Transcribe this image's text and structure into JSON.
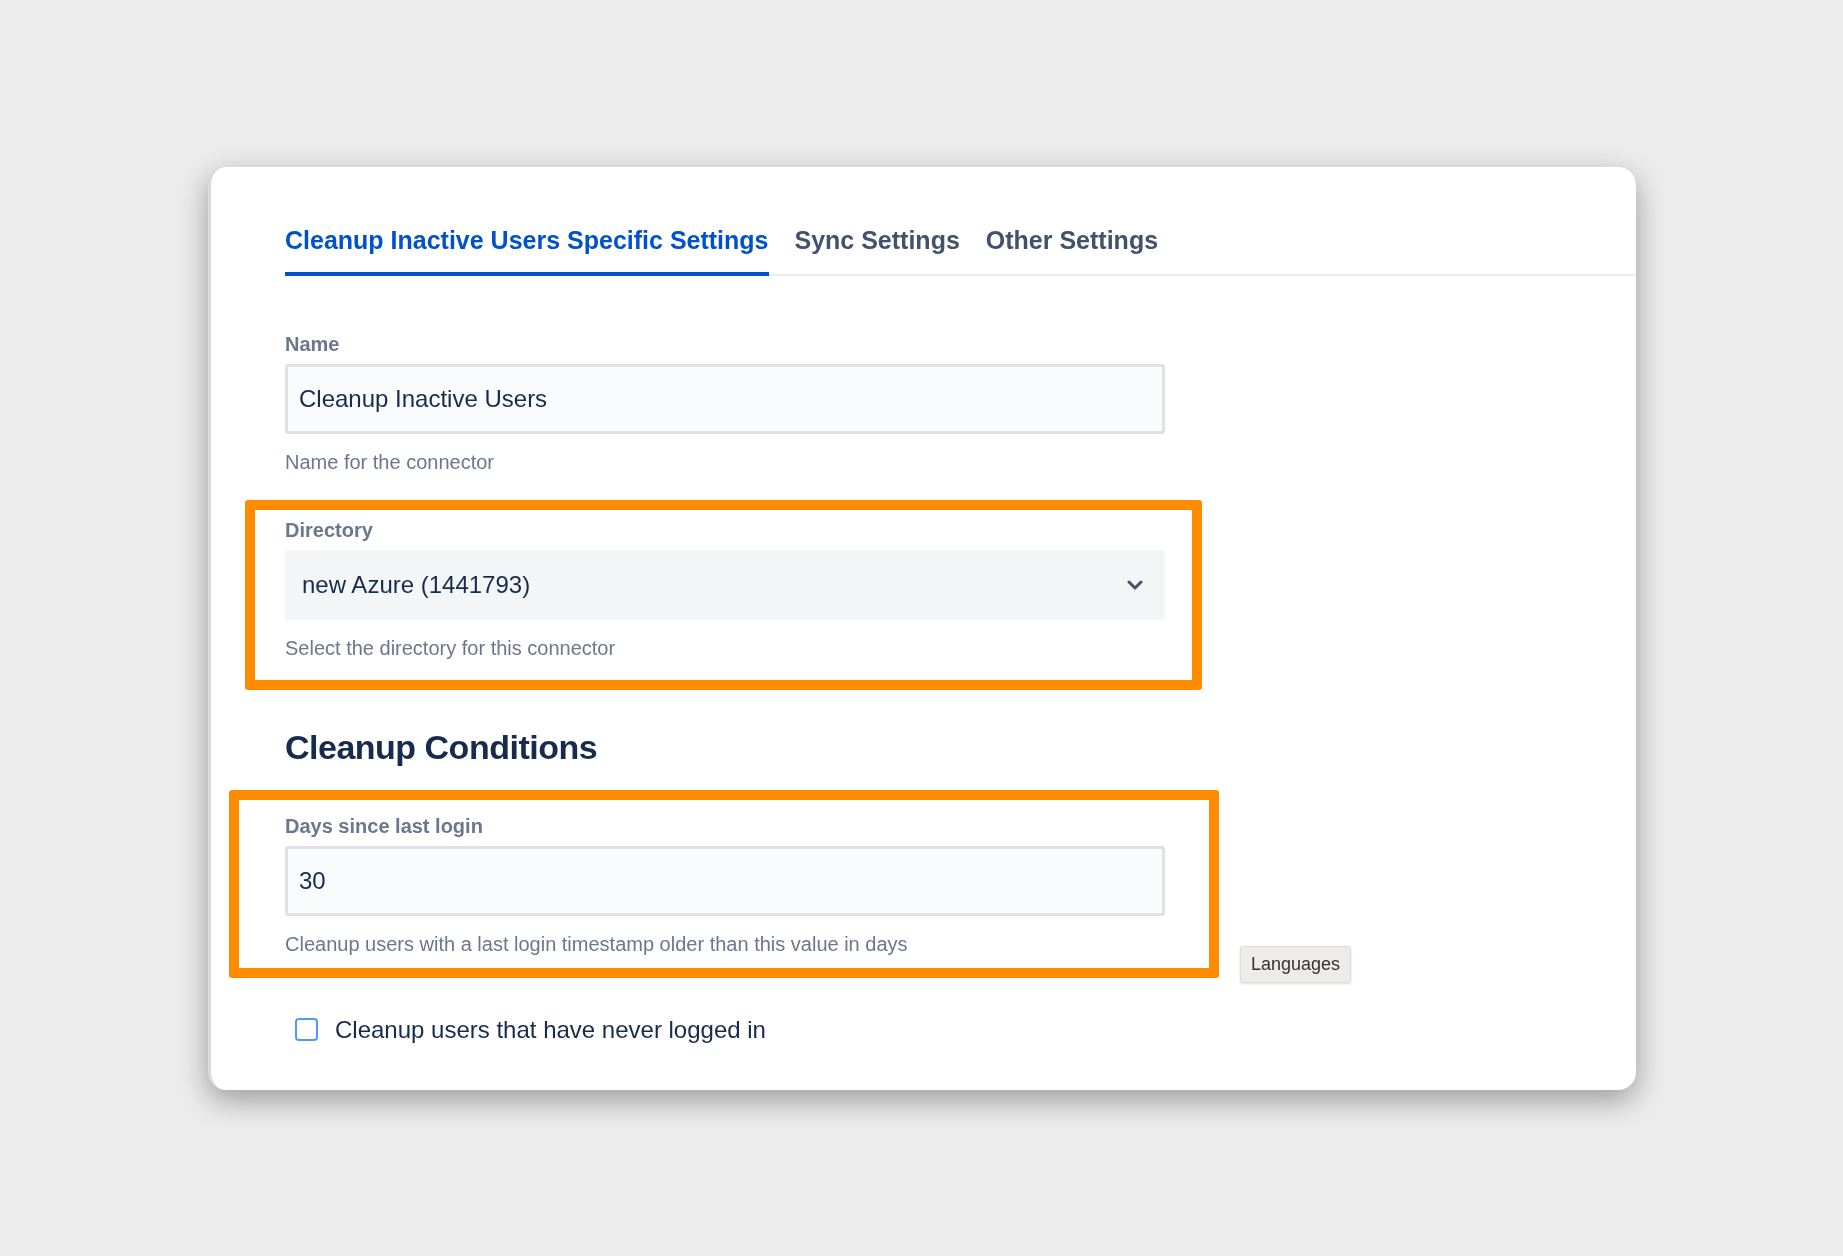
{
  "tabs": [
    {
      "label": "Cleanup Inactive Users Specific Settings",
      "selected": true
    },
    {
      "label": "Sync Settings",
      "selected": false
    },
    {
      "label": "Other Settings",
      "selected": false
    }
  ],
  "fields": [
    {
      "kind": "text",
      "label": "Name",
      "value": "Cleanup Inactive Users",
      "hint": "Name for the connector",
      "highlighted": false
    },
    {
      "kind": "select",
      "label": "Directory",
      "value": "new Azure (1441793)",
      "hint": "Select the directory for this connector",
      "highlighted": true
    }
  ],
  "section_title": "Cleanup Conditions",
  "conditions": [
    {
      "kind": "text",
      "label": "Days since last login",
      "value": "30",
      "hint": "Cleanup users with a last login timestamp older than this value in days",
      "highlighted": true
    }
  ],
  "tooltip": "Languages",
  "checkbox": {
    "label": "Cleanup users that have never logged in",
    "checked": false
  }
}
